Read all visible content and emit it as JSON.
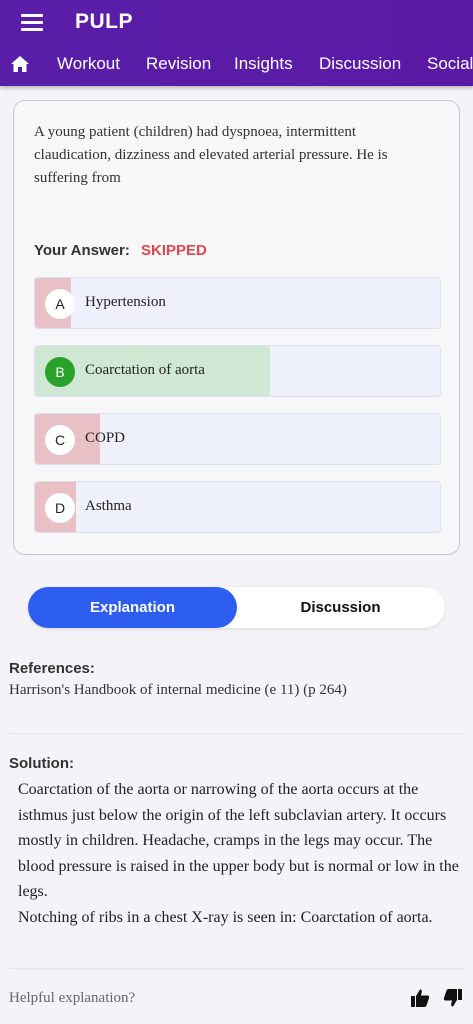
{
  "app": {
    "title": "PULP"
  },
  "nav": {
    "items": [
      {
        "label": "Workout"
      },
      {
        "label": "Revision"
      },
      {
        "label": "Insights"
      },
      {
        "label": "Discussion"
      },
      {
        "label": "Social"
      }
    ]
  },
  "question": {
    "text": "A young patient (children) had dyspnoea, intermittent claudication, dizziness and elevated arterial pressure. He is suffering from",
    "your_answer_label": "Your Answer:",
    "your_answer_value": "SKIPPED",
    "options": [
      {
        "letter": "A",
        "text": "Hypertension",
        "status": "incorrect",
        "percent": 9
      },
      {
        "letter": "B",
        "text": "Coarctation of aorta",
        "status": "correct",
        "percent": 58
      },
      {
        "letter": "C",
        "text": "COPD",
        "status": "incorrect",
        "percent": 16
      },
      {
        "letter": "D",
        "text": "Asthma",
        "status": "incorrect",
        "percent": 10
      }
    ]
  },
  "tabs": {
    "explanation": "Explanation",
    "discussion": "Discussion",
    "active": "Explanation"
  },
  "references": {
    "heading": "References:",
    "text": "Harrison's Handbook of internal medicine (e 11) (p 264)"
  },
  "solution": {
    "heading": "Solution:",
    "paragraph1": "Coarctation of the aorta or narrowing of the aorta occurs at the isthmus just below the origin of the left subclavian artery. It occurs mostly in children. Headache, cramps in the legs may occur. The blood pressure is raised in the upper body but is normal or low in the legs.",
    "paragraph2": "Notching of ribs in a chest X-ray is seen in: Coarctation of aorta."
  },
  "feedback": {
    "prompt": "Helpful explanation?"
  },
  "colors": {
    "appbar": "#5a1ea8",
    "incorrect_fill": "#e8c0c6",
    "correct_fill": "#cfe8d4",
    "correct_badge": "#2aa22a",
    "skipped": "#e0474c",
    "tab_active": "#2e5ef0"
  },
  "icons": [
    "menu-icon",
    "home-icon",
    "thumbs-up-icon",
    "thumbs-down-icon"
  ]
}
